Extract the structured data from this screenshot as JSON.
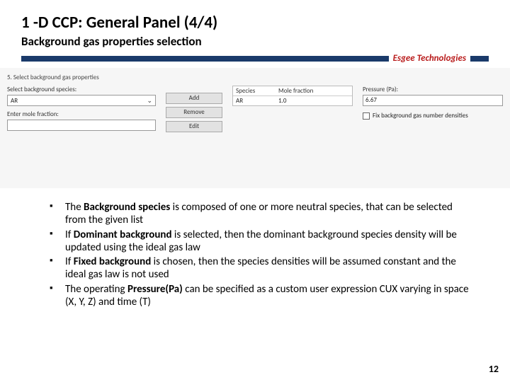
{
  "header": {
    "title": "1 -D CCP: General Panel (4/4)",
    "subtitle": "Background gas properties selection",
    "brand_prefix": "Esgee",
    "brand_suffix": "Technologies"
  },
  "panel": {
    "step_label": "5. Select background gas properties",
    "left": {
      "species_label": "Select background species:",
      "species_value": "AR",
      "mole_label": "Enter mole fraction:",
      "mole_value": ""
    },
    "buttons": {
      "add": "Add",
      "remove": "Remove",
      "edit": "Edit"
    },
    "table": {
      "col1": "Species",
      "col2": "Mole fraction",
      "rows": [
        {
          "species": "AR",
          "mole": "1.0"
        }
      ]
    },
    "right": {
      "pressure_label": "Pressure (Pa):",
      "pressure_value": "6.67",
      "fix_label": "Fix background gas number densities"
    }
  },
  "bullets": {
    "b1_pre": "The ",
    "b1_bold": "Background species",
    "b1_post": " is composed of one or more neutral species, that can be selected from the given list",
    "b2_pre": "If ",
    "b2_bold": "Dominant background",
    "b2_post": " is selected, then the dominant background species density will be updated using the ideal gas law",
    "b3_pre": "If ",
    "b3_bold": "Fixed background",
    "b3_post": " is chosen, then the species densities will be assumed constant and the ideal gas law is not used",
    "b4_pre": "The operating ",
    "b4_bold": "Pressure(Pa)",
    "b4_post": " can be specified as a custom user expression CUX varying in space (X, Y, Z) and time (T)"
  },
  "page_number": "12"
}
